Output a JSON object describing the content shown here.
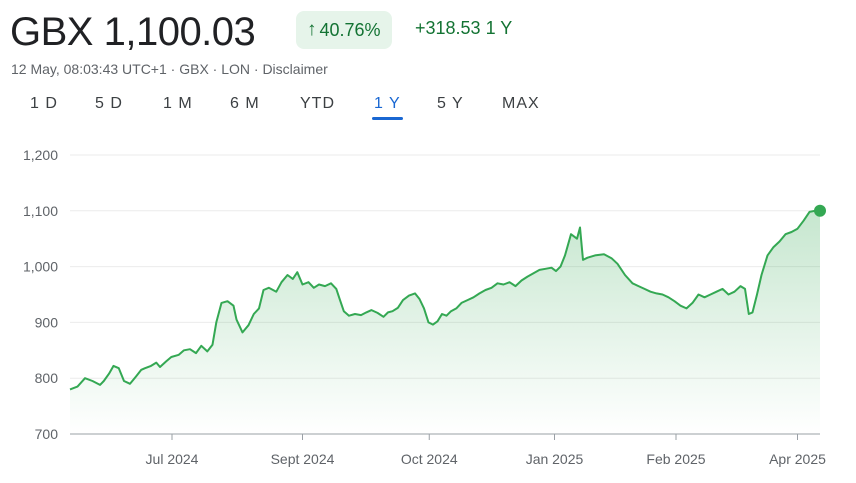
{
  "quote": {
    "price": "GBX 1,100.03",
    "change_pct": "40.76%",
    "change_arrow": "↑",
    "change_abs": "+318.53 1 Y",
    "meta": "12 May, 08:03:43 UTC+1 · GBX · LON · Disclaimer",
    "up_color": "#137333",
    "chip_bg": "#e6f4ea"
  },
  "tabs": [
    {
      "label": "1 D",
      "active": false
    },
    {
      "label": "5 D",
      "active": false
    },
    {
      "label": "1 M",
      "active": false
    },
    {
      "label": "6 M",
      "active": false
    },
    {
      "label": "YTD",
      "active": false
    },
    {
      "label": "1 Y",
      "active": true
    },
    {
      "label": "5 Y",
      "active": false
    },
    {
      "label": "MAX",
      "active": false
    }
  ],
  "chart_data": {
    "type": "area",
    "title": "",
    "xlabel": "",
    "ylabel": "",
    "ylim": [
      700,
      1200
    ],
    "yticks": [
      "700",
      "800",
      "900",
      "1,000",
      "1,100",
      "1,200"
    ],
    "grid": true,
    "line_color": "#34a853",
    "xticks": [
      {
        "label": "Jul 2024",
        "t": 0.136
      },
      {
        "label": "Sept 2024",
        "t": 0.31
      },
      {
        "label": "Oct 2024",
        "t": 0.479
      },
      {
        "label": "Jan 2025",
        "t": 0.646
      },
      {
        "label": "Feb 2025",
        "t": 0.808
      },
      {
        "label": "Apr 2025",
        "t": 0.97
      }
    ],
    "series": [
      {
        "values": [
          [
            0.0,
            780
          ],
          [
            0.01,
            785
          ],
          [
            0.02,
            800
          ],
          [
            0.03,
            795
          ],
          [
            0.04,
            788
          ],
          [
            0.045,
            795
          ],
          [
            0.052,
            808
          ],
          [
            0.058,
            822
          ],
          [
            0.065,
            818
          ],
          [
            0.072,
            795
          ],
          [
            0.08,
            790
          ],
          [
            0.088,
            803
          ],
          [
            0.095,
            815
          ],
          [
            0.1,
            818
          ],
          [
            0.108,
            822
          ],
          [
            0.115,
            828
          ],
          [
            0.12,
            820
          ],
          [
            0.128,
            830
          ],
          [
            0.135,
            838
          ],
          [
            0.145,
            842
          ],
          [
            0.152,
            850
          ],
          [
            0.16,
            852
          ],
          [
            0.168,
            845
          ],
          [
            0.175,
            858
          ],
          [
            0.183,
            848
          ],
          [
            0.19,
            860
          ],
          [
            0.195,
            900
          ],
          [
            0.202,
            935
          ],
          [
            0.21,
            938
          ],
          [
            0.218,
            930
          ],
          [
            0.222,
            905
          ],
          [
            0.23,
            882
          ],
          [
            0.238,
            895
          ],
          [
            0.245,
            915
          ],
          [
            0.252,
            925
          ],
          [
            0.258,
            958
          ],
          [
            0.265,
            962
          ],
          [
            0.275,
            955
          ],
          [
            0.282,
            972
          ],
          [
            0.29,
            985
          ],
          [
            0.297,
            978
          ],
          [
            0.303,
            990
          ],
          [
            0.31,
            968
          ],
          [
            0.318,
            972
          ],
          [
            0.325,
            962
          ],
          [
            0.332,
            968
          ],
          [
            0.34,
            965
          ],
          [
            0.348,
            970
          ],
          [
            0.355,
            960
          ],
          [
            0.36,
            940
          ],
          [
            0.365,
            920
          ],
          [
            0.372,
            912
          ],
          [
            0.38,
            915
          ],
          [
            0.388,
            913
          ],
          [
            0.395,
            918
          ],
          [
            0.402,
            922
          ],
          [
            0.41,
            917
          ],
          [
            0.418,
            910
          ],
          [
            0.424,
            918
          ],
          [
            0.43,
            920
          ],
          [
            0.437,
            926
          ],
          [
            0.444,
            940
          ],
          [
            0.452,
            948
          ],
          [
            0.46,
            952
          ],
          [
            0.466,
            942
          ],
          [
            0.472,
            925
          ],
          [
            0.478,
            900
          ],
          [
            0.484,
            896
          ],
          [
            0.49,
            902
          ],
          [
            0.496,
            915
          ],
          [
            0.502,
            912
          ],
          [
            0.508,
            920
          ],
          [
            0.515,
            925
          ],
          [
            0.522,
            935
          ],
          [
            0.53,
            940
          ],
          [
            0.538,
            945
          ],
          [
            0.546,
            952
          ],
          [
            0.554,
            958
          ],
          [
            0.562,
            962
          ],
          [
            0.57,
            970
          ],
          [
            0.578,
            968
          ],
          [
            0.586,
            972
          ],
          [
            0.594,
            965
          ],
          [
            0.602,
            975
          ],
          [
            0.61,
            982
          ],
          [
            0.618,
            988
          ],
          [
            0.626,
            994
          ],
          [
            0.634,
            996
          ],
          [
            0.642,
            998
          ],
          [
            0.648,
            992
          ],
          [
            0.654,
            1000
          ],
          [
            0.66,
            1020
          ],
          [
            0.668,
            1058
          ],
          [
            0.676,
            1050
          ],
          [
            0.68,
            1070
          ],
          [
            0.684,
            1012
          ],
          [
            0.69,
            1016
          ],
          [
            0.7,
            1020
          ],
          [
            0.712,
            1022
          ],
          [
            0.722,
            1015
          ],
          [
            0.73,
            1005
          ],
          [
            0.74,
            985
          ],
          [
            0.75,
            970
          ],
          [
            0.758,
            965
          ],
          [
            0.766,
            960
          ],
          [
            0.774,
            955
          ],
          [
            0.782,
            952
          ],
          [
            0.79,
            950
          ],
          [
            0.798,
            945
          ],
          [
            0.806,
            938
          ],
          [
            0.814,
            930
          ],
          [
            0.822,
            925
          ],
          [
            0.83,
            935
          ],
          [
            0.838,
            950
          ],
          [
            0.846,
            945
          ],
          [
            0.854,
            950
          ],
          [
            0.862,
            955
          ],
          [
            0.87,
            960
          ],
          [
            0.878,
            950
          ],
          [
            0.886,
            955
          ],
          [
            0.894,
            965
          ],
          [
            0.9,
            960
          ],
          [
            0.905,
            915
          ],
          [
            0.91,
            918
          ],
          [
            0.916,
            950
          ],
          [
            0.922,
            985
          ],
          [
            0.93,
            1020
          ],
          [
            0.938,
            1035
          ],
          [
            0.946,
            1045
          ],
          [
            0.954,
            1058
          ],
          [
            0.962,
            1062
          ],
          [
            0.97,
            1068
          ],
          [
            0.978,
            1082
          ],
          [
            0.986,
            1098
          ],
          [
            0.993,
            1100
          ],
          [
            1.0,
            1100
          ]
        ]
      }
    ]
  }
}
